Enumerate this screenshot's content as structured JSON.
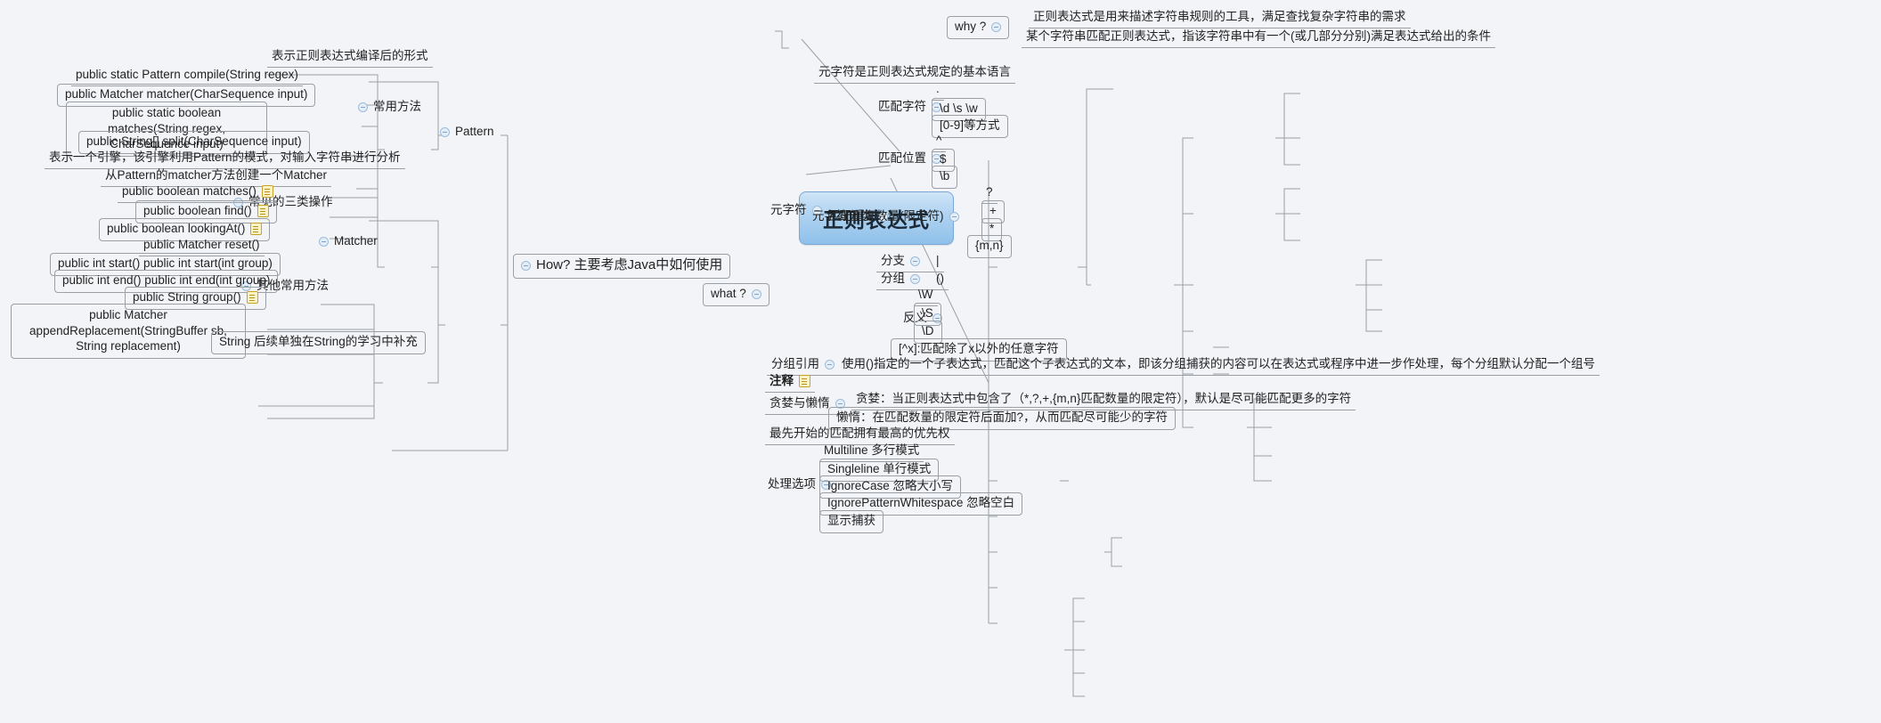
{
  "theme": {
    "background": "#f2f4f8",
    "center_fill": "#aed2f0",
    "center_border": "#7ba7d7",
    "node_border": "#9aa0a6",
    "note_icon": "#fdf3c4",
    "collapse_dot": "#e4eef8"
  },
  "center": {
    "label": "正则表达式"
  },
  "why": {
    "label": "why ?",
    "items": [
      "正则表达式是用来描述字符串规则的工具，满足查找复杂字符串的需求",
      "某个字符串匹配正则表达式，指该字符串中有一个(或几部分分别)满足表达式给出的条件"
    ]
  },
  "how": {
    "label": "How? 主要考虑Java中如何使用",
    "pattern": {
      "label": "Pattern",
      "desc": "表示正则表达式编译后的形式",
      "methods_label": "常用方法",
      "methods": [
        "public static Pattern compile(String regex)",
        "public Matcher matcher(CharSequence input)",
        "public static boolean matches(String regex, CharSequence input)",
        "public String[] split(CharSequence input)"
      ]
    },
    "matcher": {
      "label": "Matcher",
      "desc": "表示一个引擎，该引擎利用Pattern的模式，对输入字符串进行分析",
      "create": "从Pattern的matcher方法创建一个Matcher",
      "three_ops_label": "常见的三类操作",
      "three_ops": [
        {
          "text": "public boolean matches()",
          "note": true
        },
        {
          "text": "public boolean find()",
          "note": true
        },
        {
          "text": "public boolean lookingAt()",
          "note": true
        }
      ],
      "other_label": "其他常用方法",
      "other": [
        {
          "text": "public Matcher reset()",
          "note": false
        },
        {
          "text": "public int start() public int start(int group)",
          "note": false
        },
        {
          "text": "public int end() public int end(int group)",
          "note": false
        },
        {
          "text": "public String group()",
          "note": true
        },
        {
          "text": "public Matcher appendReplacement(StringBuffer sb, String replacement)",
          "note": false
        }
      ]
    },
    "string": "String 后续单独在String的学习中补充"
  },
  "what": {
    "label": "what ?",
    "metachar": {
      "label": "元字符",
      "desc": "元字符是正则表达式规定的基本语言",
      "category_label": "元字符分类",
      "match_char": {
        "label": "匹配字符",
        "items": [
          ".",
          "\\d          \\s          \\w",
          "[0-9]等方式"
        ]
      },
      "match_pos": {
        "label": "匹配位置",
        "items": [
          "^",
          "$",
          "\\b"
        ]
      },
      "match_repeat": {
        "label": "匹配重复数量(限定符)",
        "items": [
          "?",
          "+",
          "*",
          "{m,n}"
        ]
      },
      "branch": {
        "label": "分支",
        "value": "|"
      },
      "group": {
        "label": "分组",
        "value": "()"
      },
      "negation": {
        "label": "反义",
        "items": [
          "\\W",
          "\\S",
          "\\D",
          "[^x]:匹配除了x以外的任意字符"
        ]
      }
    },
    "group_ref": {
      "label": "分组引用",
      "text": "使用()指定的一个子表达式，匹配这个子表达式的文本，即该分组捕获的内容可以在表达式或程序中进一步作处理，每个分组默认分配一个组号"
    },
    "comment": {
      "label": "注释",
      "note": true
    },
    "greedy_lazy": {
      "label": "贪婪与懒惰",
      "items": [
        "贪婪：当正则表达式中包含了（*,?,+,{m,n}匹配数量的限定符），默认是尽可能匹配更多的字符",
        "懒惰：在匹配数量的限定符后面加?，从而匹配尽可能少的字符"
      ]
    },
    "priority": "最先开始的匹配拥有最高的优先权",
    "options": {
      "label": "处理选项",
      "items": [
        "Multiline 多行模式",
        "Singleline 单行模式",
        "IgnoreCase 忽略大小写",
        "IgnorePatternWhitespace 忽略空白",
        "显示捕获"
      ]
    }
  }
}
